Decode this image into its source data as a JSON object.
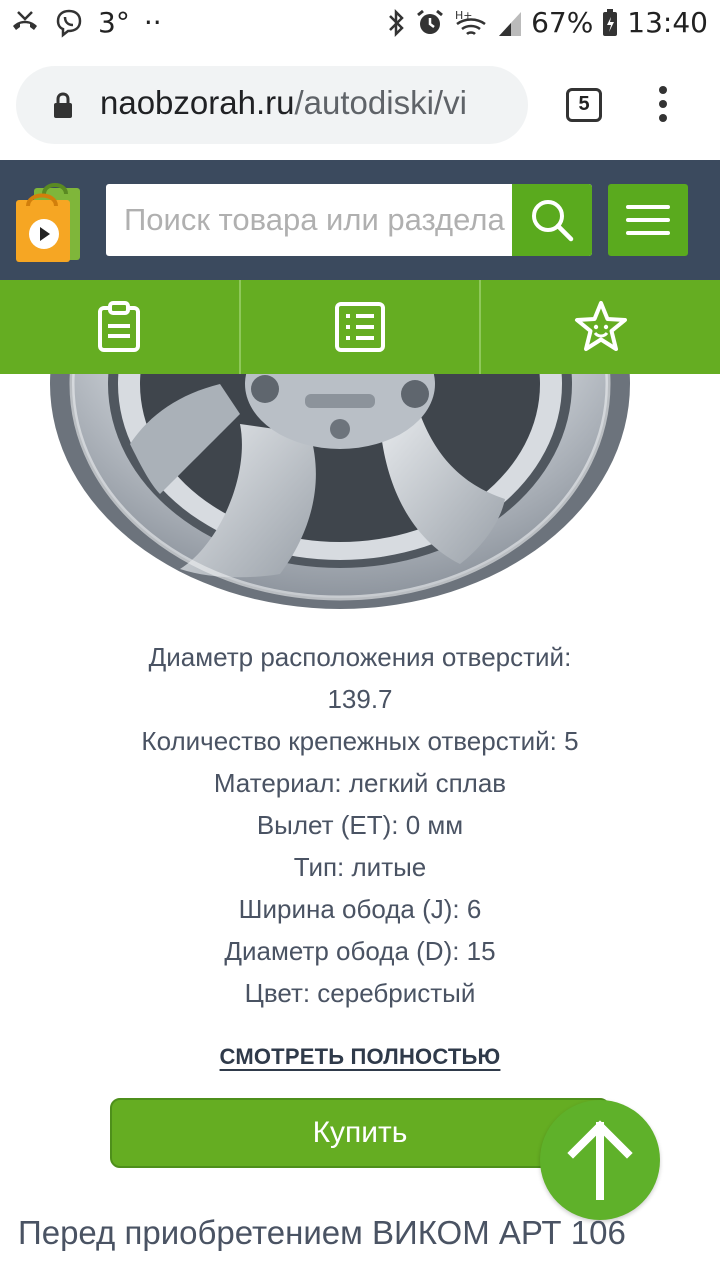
{
  "status_bar": {
    "notif_temp": "3°",
    "network": "H+",
    "battery": "67%",
    "time": "13:40"
  },
  "browser": {
    "url_host": "naobzorah.ru",
    "url_path": "/autodiski/vi",
    "tab_count": "5"
  },
  "site_header": {
    "search_placeholder": "Поиск товара или раздела"
  },
  "nav_icons": [
    "clipboard-icon",
    "list-icon",
    "star-icon"
  ],
  "specs": [
    "Диаметр расположения отверстий:",
    "139.7",
    "Количество крепежных отверстий: 5",
    "Материал: легкий сплав",
    "Вылет (ET): 0 мм",
    "Тип: литые",
    "Ширина обода (J): 6",
    "Диаметр обода (D): 15",
    "Цвет: серебристый"
  ],
  "more_link": "СМОТРЕТЬ ПОЛНОСТЬЮ",
  "buy_button": "Купить",
  "bottom_heading": "Перед приобретением ВИКОМ АРТ 106",
  "colors": {
    "header_bg": "#3b4a5e",
    "accent_green": "#65ad22",
    "text": "#4a5363"
  }
}
